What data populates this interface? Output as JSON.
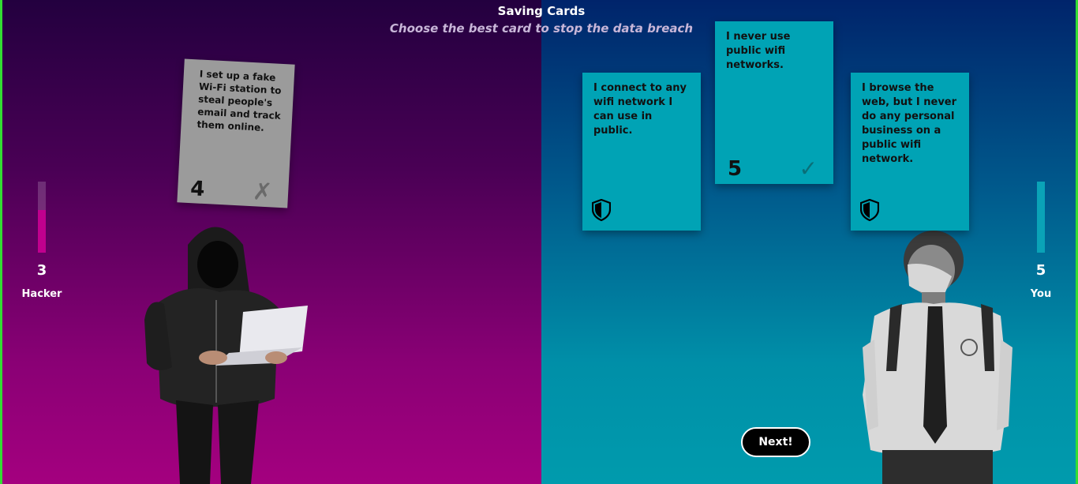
{
  "header": {
    "title": "Saving Cards",
    "subtitle": "Choose the best card to stop the data breach"
  },
  "players": {
    "hacker": {
      "label": "Hacker",
      "score": "3",
      "meter_level": 0.6,
      "color": "#c0008e"
    },
    "you": {
      "label": "You",
      "score": "5",
      "meter_level": 1.0,
      "color": "#0aa3b7"
    }
  },
  "hacker_card": {
    "text": "I set up a fake Wi-Fi station to steal people's email and track them online.",
    "value": "4",
    "mark": "✗",
    "color": "#9b9b9b"
  },
  "player_cards": [
    {
      "text": "I connect to any wifi network I can use in public.",
      "icon": "shield-icon"
    },
    {
      "text": "I never use public wifi networks.",
      "value": "5",
      "mark": "✓",
      "selected": true
    },
    {
      "text": "I browse the web, but I never do any personal business on a public wifi network.",
      "icon": "shield-icon"
    }
  ],
  "colors": {
    "hacker_bg": "#a4007f",
    "player_bg": "#009bad",
    "card_teal": "#00a3b5"
  },
  "next_button": {
    "label": "Next!"
  }
}
